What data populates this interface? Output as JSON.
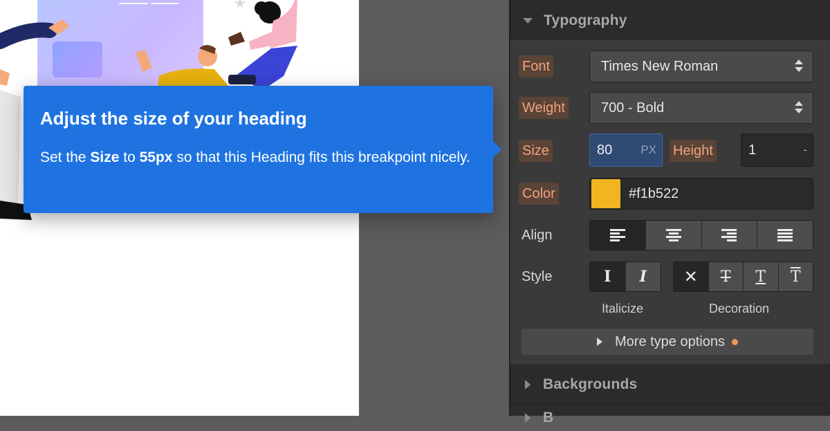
{
  "panel": {
    "typography_title": "Typography",
    "backgrounds_title": "Backgrounds",
    "next_title_fragment": "B",
    "font": {
      "label": "Font",
      "value": "Times New Roman"
    },
    "weight": {
      "label": "Weight",
      "value": "700 - Bold"
    },
    "size": {
      "label": "Size",
      "value": "80",
      "unit": "PX"
    },
    "height": {
      "label": "Height",
      "value": "1",
      "unit": "-"
    },
    "color": {
      "label": "Color",
      "value": "#f1b522",
      "swatch": "#f1b522"
    },
    "align": {
      "label": "Align",
      "options": [
        "align-left-icon",
        "align-center-icon",
        "align-right-icon",
        "align-justify-icon"
      ],
      "selected": 0
    },
    "style": {
      "label": "Style",
      "italicize_caption": "Italicize",
      "decoration_caption": "Decoration"
    },
    "more_options": "More type options"
  },
  "tooltip": {
    "title": "Adjust the size of your heading",
    "body_prefix": "Set the ",
    "body_bold_1": "Size",
    "body_mid": " to ",
    "body_bold_2": "55px",
    "body_suffix": " so that this Heading fits this breakpoint nicely."
  },
  "colors": {
    "accent": "#1f73e0",
    "orange_label": "#f0a57c",
    "panel_bg": "#2b2b2b"
  }
}
